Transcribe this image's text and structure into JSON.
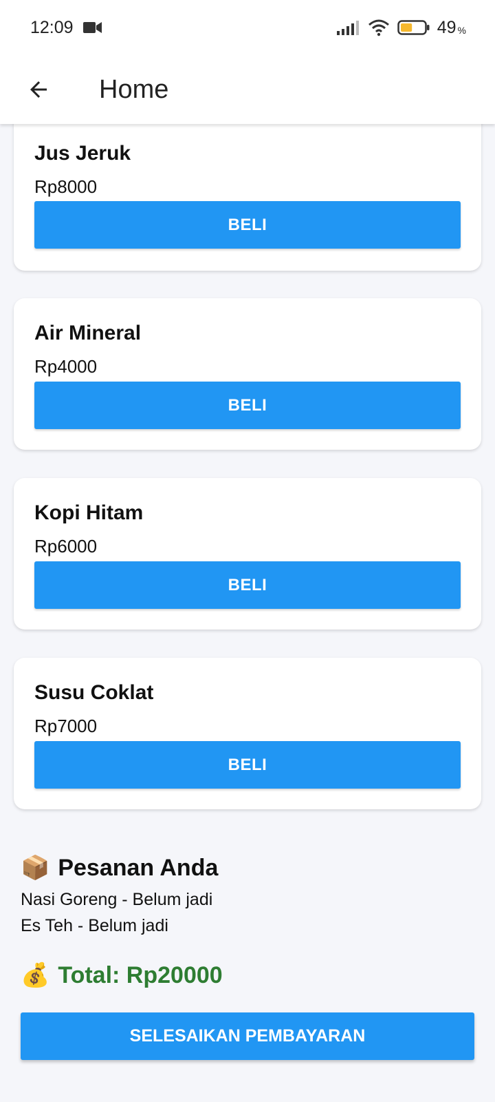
{
  "status_bar": {
    "time": "12:09",
    "battery_percent": "49",
    "battery_percent_sign": "%",
    "battery_level": 0.49,
    "icons": [
      "video-camera-icon",
      "signal-icon",
      "wifi-icon",
      "battery-icon"
    ]
  },
  "app_bar": {
    "title": "Home",
    "back_icon": "arrow-back-icon"
  },
  "menu": [
    {
      "name": "Jus Jeruk",
      "price": "Rp8000",
      "button": "BELI"
    },
    {
      "name": "Air Mineral",
      "price": "Rp4000",
      "button": "BELI"
    },
    {
      "name": "Kopi Hitam",
      "price": "Rp6000",
      "button": "BELI"
    },
    {
      "name": "Susu Coklat",
      "price": "Rp7000",
      "button": "BELI"
    }
  ],
  "orders": {
    "emoji": "📦",
    "title": "Pesanan Anda",
    "items": [
      "Nasi Goreng - Belum jadi",
      "Es Teh - Belum jadi"
    ]
  },
  "total": {
    "emoji": "💰",
    "text": "Total: Rp20000"
  },
  "pay_button": "SELESAIKAN PEMBAYARAN",
  "colors": {
    "primary": "#2196f3",
    "total_green": "#2e7d32",
    "background": "#f5f6fa",
    "battery_fill": "#f5b82e"
  }
}
